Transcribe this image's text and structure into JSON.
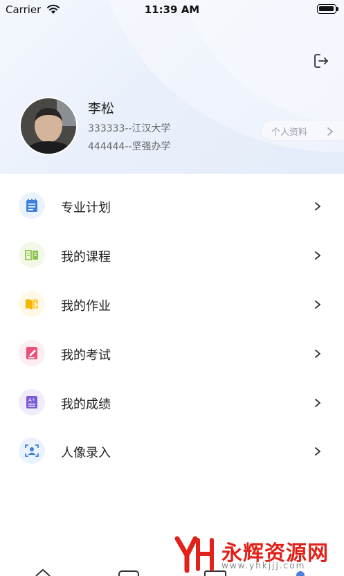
{
  "status_bar": {
    "carrier": "Carrier",
    "time": "11:39 AM"
  },
  "profile": {
    "name": "李松",
    "line1": "333333--江汉大学",
    "line2": "444444--坚强办学",
    "profile_button_label": "个人资料"
  },
  "menu": {
    "items": [
      {
        "label": "专业计划",
        "icon": "notebook-icon",
        "color": "#3f7fdc",
        "bg": "#eaf2fd"
      },
      {
        "label": "我的课程",
        "icon": "open-book-icon",
        "color": "#8bc34a",
        "bg": "#f3f9e9"
      },
      {
        "label": "我的作业",
        "icon": "homework-book-icon",
        "color": "#f4b400",
        "bg": "#fff8e6"
      },
      {
        "label": "我的考试",
        "icon": "exam-paper-icon",
        "color": "#e9507a",
        "bg": "#fdecf1"
      },
      {
        "label": "我的成绩",
        "icon": "grade-report-icon",
        "color": "#7b5cd6",
        "bg": "#f0ecfb"
      },
      {
        "label": "人像录入",
        "icon": "face-scan-icon",
        "color": "#3f7fdc",
        "bg": "#eaf2fd"
      }
    ]
  },
  "watermark": {
    "text": "永辉资源网",
    "url": "www.yhkjjj.com",
    "brand_color": "#e0221a"
  }
}
